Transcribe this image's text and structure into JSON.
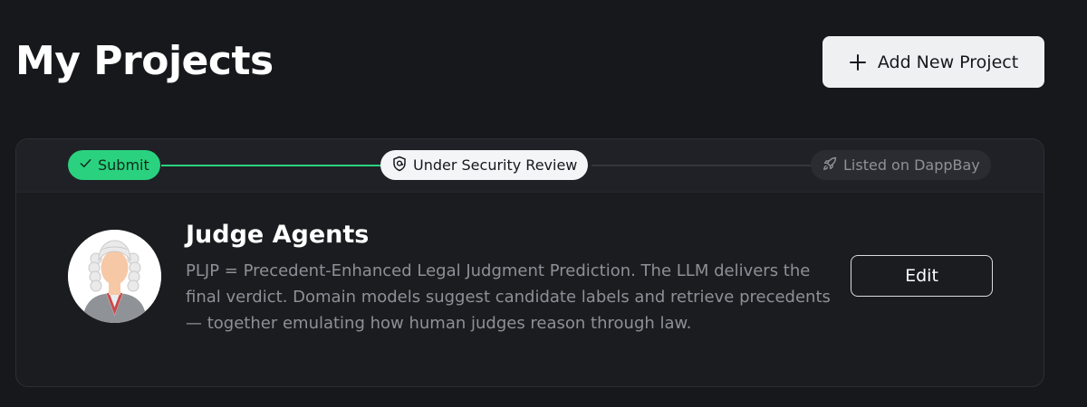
{
  "header": {
    "title": "My Projects",
    "add_button": {
      "label": "Add New Project",
      "icon": "plus-icon"
    }
  },
  "stepper": {
    "steps": [
      {
        "label": "Submit",
        "icon": "check-icon",
        "state": "completed"
      },
      {
        "label": "Under Security Review",
        "icon": "shield-icon",
        "state": "current"
      },
      {
        "label": "Listed on DappBay",
        "icon": "rocket-icon",
        "state": "pending"
      }
    ]
  },
  "project": {
    "name": "Judge Agents",
    "description": "PLJP = Precedent-Enhanced Legal Judgment Prediction. The LLM delivers the final verdict. Domain models suggest candidate labels and retrieve precedents — together emulating how human judges reason through law.",
    "avatar": "judge-avatar",
    "edit_label": "Edit"
  },
  "colors": {
    "background": "#17181c",
    "card": "#1b1c20",
    "accent_green": "#2ad27f",
    "muted_text": "#8d9097",
    "button_light": "#eff0f2"
  }
}
